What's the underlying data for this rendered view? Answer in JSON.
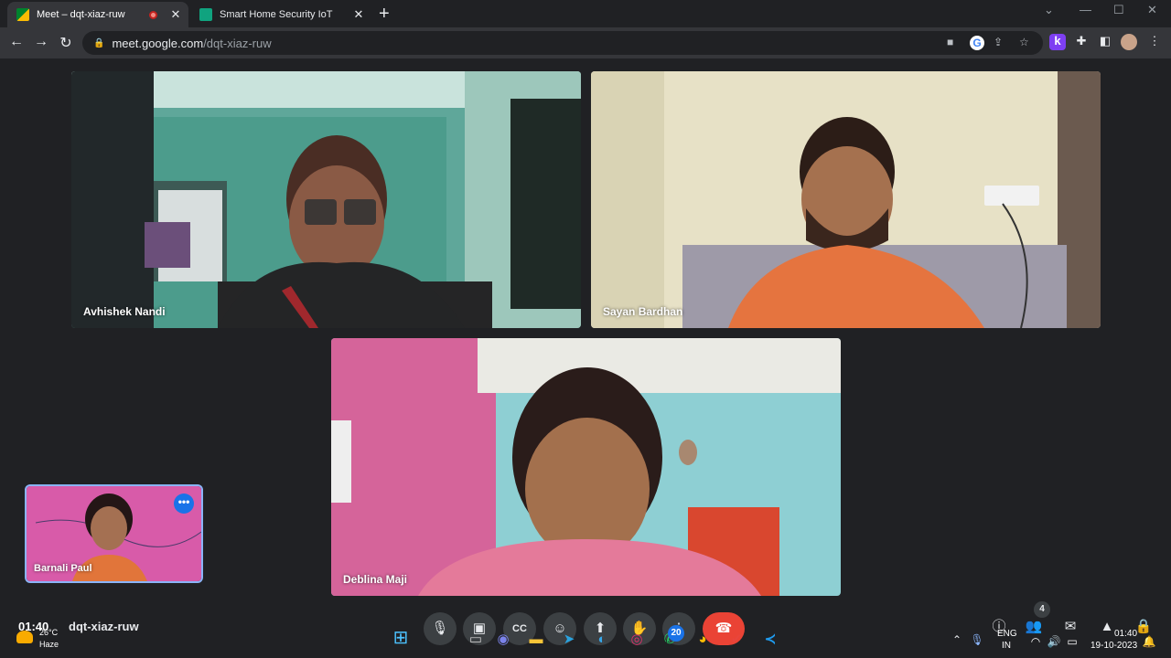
{
  "browser": {
    "tabs": [
      {
        "title": "Meet – dqt-xiaz-ruw",
        "active": true,
        "recording": true
      },
      {
        "title": "Smart Home Security IoT",
        "active": false
      }
    ],
    "new_tab_symbol": "+",
    "address": {
      "host": "meet.google.com",
      "path": "/dqt-xiaz-ruw"
    },
    "profile_letter": "k"
  },
  "meeting": {
    "code": "dqt-xiaz-ruw",
    "time": "01:40",
    "participants": [
      {
        "name": "Avhishek Nandi"
      },
      {
        "name": "Sayan Bardhan"
      },
      {
        "name": "Deblina Maji"
      }
    ],
    "self": {
      "name": "Barnali Paul"
    },
    "participant_count": "4"
  },
  "taskbar": {
    "weather": {
      "temp": "26°C",
      "condition": "Haze"
    },
    "language": "ENG",
    "region": "IN",
    "clock_time": "01:40",
    "clock_date": "19-10-2023",
    "whatsapp_badge": "20"
  },
  "colors": {
    "accent": "#8ab4f8",
    "end_call": "#ea4335",
    "background": "#202124"
  }
}
